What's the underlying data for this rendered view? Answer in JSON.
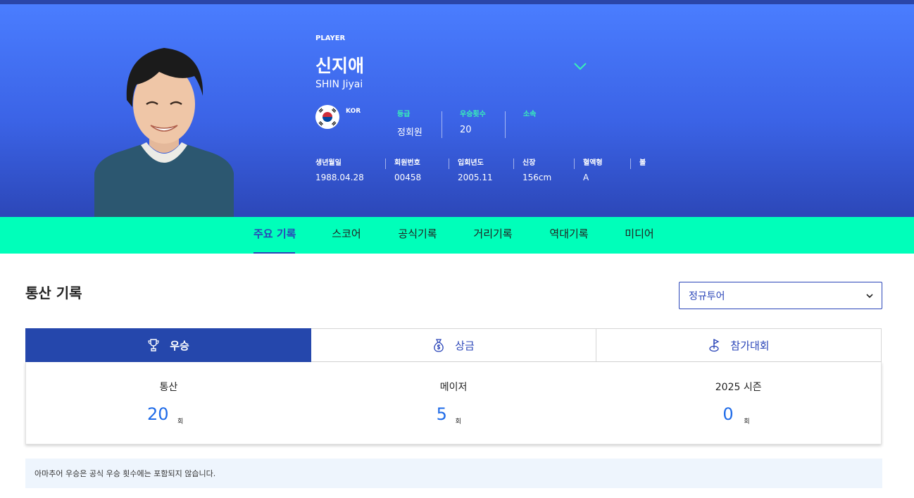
{
  "header": {
    "label": "PLAYER",
    "name_ko": "신지애",
    "name_en": "SHIN Jiyai",
    "country": "KOR",
    "stats": [
      {
        "label": "등급",
        "value": "정회원"
      },
      {
        "label": "우승횟수",
        "value": "20"
      },
      {
        "label": "소속",
        "value": ""
      }
    ],
    "details": [
      {
        "label": "생년월일",
        "value": "1988.04.28"
      },
      {
        "label": "회원번호",
        "value": "00458"
      },
      {
        "label": "입회년도",
        "value": "2005.11"
      },
      {
        "label": "신장",
        "value": "156cm"
      },
      {
        "label": "혈액형",
        "value": "A"
      },
      {
        "label": "볼",
        "value": ""
      }
    ]
  },
  "tabs": [
    "주요 기록",
    "스코어",
    "공식기록",
    "거리기록",
    "역대기록",
    "미디어"
  ],
  "active_tab": "주요 기록",
  "section": {
    "title": "통산 기록",
    "tour_select": "정규투어"
  },
  "record_tabs": [
    {
      "label": "우승",
      "icon": "trophy-icon"
    },
    {
      "label": "상금",
      "icon": "money-bag-icon"
    },
    {
      "label": "참가대회",
      "icon": "golf-flag-icon"
    }
  ],
  "records": [
    {
      "label": "통산",
      "value": "20",
      "unit": "회"
    },
    {
      "label": "메이저",
      "value": "5",
      "unit": "회"
    },
    {
      "label": "2025 시즌",
      "value": "0",
      "unit": "회"
    }
  ],
  "note": "아마추어 우승은 공식 우승 횟수에는 포함되지 않습니다.",
  "colors": {
    "hero_top": "#4a7dff",
    "hero_bottom": "#2c47b8",
    "tab_bar": "#00ffba",
    "accent": "#2a45b8",
    "stat_label": "#39f0b8",
    "number": "#1f6be8"
  }
}
